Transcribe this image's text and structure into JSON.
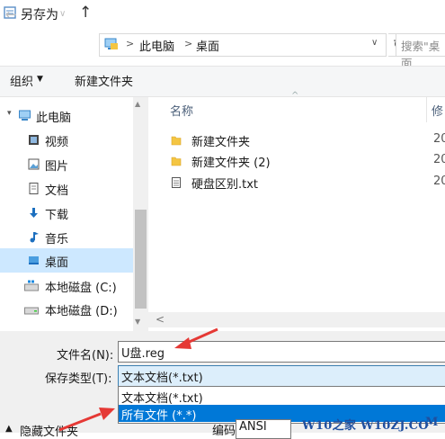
{
  "window": {
    "title": "另存为"
  },
  "address": {
    "path": [
      "此电脑",
      "桌面"
    ],
    "separator": ">",
    "search_placeholder": "搜索\"桌面"
  },
  "toolbar": {
    "organize_label": "组织",
    "new_folder_label": "新建文件夹"
  },
  "nav": {
    "items": [
      {
        "label": "此电脑",
        "icon": "computer-icon"
      },
      {
        "label": "视频",
        "icon": "video-icon"
      },
      {
        "label": "图片",
        "icon": "picture-icon"
      },
      {
        "label": "文档",
        "icon": "document-icon"
      },
      {
        "label": "下载",
        "icon": "download-icon"
      },
      {
        "label": "音乐",
        "icon": "music-icon"
      },
      {
        "label": "桌面",
        "icon": "desktop-icon",
        "selected": true
      },
      {
        "label": "本地磁盘 (C:)",
        "icon": "windows-drive-icon"
      },
      {
        "label": "本地磁盘 (D:)",
        "icon": "drive-icon"
      }
    ]
  },
  "filelist": {
    "columns": {
      "name": "名称",
      "date": "修"
    },
    "rows": [
      {
        "name": "新建文件夹",
        "date": "20",
        "icon": "folder-icon"
      },
      {
        "name": "新建文件夹 (2)",
        "date": "20",
        "icon": "folder-icon"
      },
      {
        "name": "硬盘区别.txt",
        "date": "20",
        "icon": "text-file-icon"
      }
    ]
  },
  "save": {
    "filename_label": "文件名(N):",
    "filename_value": "U盘.reg",
    "type_label": "保存类型(T):",
    "type_value": "文本文档(*.txt)",
    "type_options": [
      "文本文档(*.txt)",
      "所有文件 (*.*)"
    ],
    "hide_folders_label": "隐藏文件夹",
    "encoding_label": "编码(E):",
    "encoding_value": "ANSI"
  },
  "watermark": {
    "text": "W10之家 W10ZJ.CO",
    "suffix": "M"
  },
  "colors": {
    "selection": "#cde8ff",
    "highlight": "#0078d7",
    "arrow": "#e53935",
    "folder": "#f4c542"
  }
}
